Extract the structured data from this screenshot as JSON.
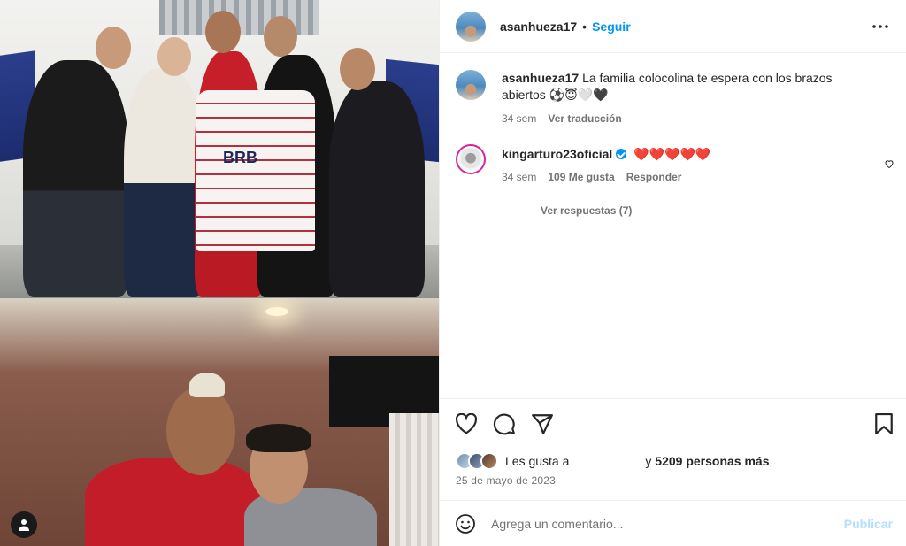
{
  "post_header": {
    "username": "asanhueza17",
    "separator": "•",
    "follow_label": "Seguir",
    "more_icon": "more-horizontal-icon"
  },
  "caption": {
    "username": "asanhueza17",
    "text": "La familia colocolina te espera con los brazos abiertos ⚽😇🤍🖤",
    "time": "34 sem",
    "translate_label": "Ver traducción"
  },
  "comment": {
    "username": "kingarturo23oficial",
    "text": "❤️❤️❤️❤️❤️",
    "time": "34 sem",
    "likes": "109 Me gusta",
    "reply_label": "Responder",
    "view_replies": "Ver respuestas (7)"
  },
  "likes": {
    "prefix": "Les gusta a",
    "middle": "y",
    "count": "5209 personas más"
  },
  "date": "25 de mayo de 2023",
  "comment_box": {
    "placeholder": "Agrega un comentario...",
    "publish_label": "Publicar"
  },
  "colors": {
    "accent": "#0095f6",
    "text": "#262626",
    "muted": "#737373",
    "border": "#efefef",
    "publish_disabled": "#b2dffc"
  }
}
